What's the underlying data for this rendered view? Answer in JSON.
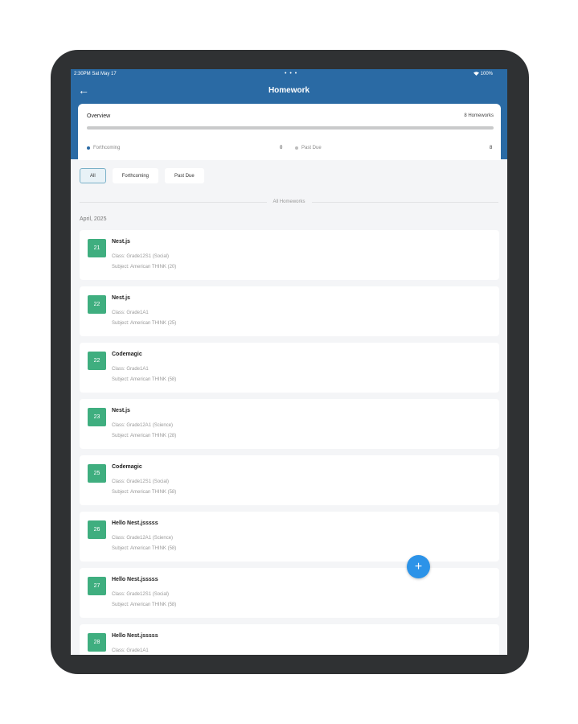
{
  "status_bar": {
    "time": "2:30PM  Sat May 17",
    "dots": "• • •",
    "battery": "100%"
  },
  "header": {
    "back_icon": "arrow-left-icon",
    "title": "Homework"
  },
  "overview": {
    "title": "Overview",
    "count": "8 Homeworks",
    "progress_fraction": 0,
    "legend": [
      {
        "label": "Forthcoming",
        "value": "0",
        "color": "#2a6aa4"
      },
      {
        "label": "Past Due",
        "value": "8",
        "color": "#bdbdbd"
      }
    ]
  },
  "filters": [
    {
      "label": "All",
      "active": true
    },
    {
      "label": "Forthcoming",
      "active": false
    },
    {
      "label": "Past Due",
      "active": false
    }
  ],
  "section_label": "All Homeworks",
  "month_label": "April, 2025",
  "homeworks": [
    {
      "day": "21",
      "title": "Nest.js",
      "class": "Class: Grade12S1 (Social)",
      "subject": "Subject: American THINK (20)"
    },
    {
      "day": "22",
      "title": "Nest.js",
      "class": "Class: Grade1A1",
      "subject": "Subject: American THINK (25)"
    },
    {
      "day": "22",
      "title": "Codemagic",
      "class": "Class: Grade1A1",
      "subject": "Subject: American THINK (58)"
    },
    {
      "day": "23",
      "title": "Nest.js",
      "class": "Class: Grade12A1 (Science)",
      "subject": "Subject: American THINK (28)"
    },
    {
      "day": "25",
      "title": "Codemagic",
      "class": "Class: Grade12S1 (Social)",
      "subject": "Subject: American THINK (58)"
    },
    {
      "day": "26",
      "title": "Hello Nest.jsssss",
      "class": "Class: Grade12A1 (Science)",
      "subject": "Subject: American THINK (58)"
    },
    {
      "day": "27",
      "title": "Hello Nest.jsssss",
      "class": "Class: Grade12S1 (Social)",
      "subject": "Subject: American THINK (58)"
    },
    {
      "day": "28",
      "title": "Hello Nest.jsssss",
      "class": "Class: Grade1A1",
      "subject": ""
    }
  ],
  "fab": {
    "icon": "plus-icon",
    "glyph": "+"
  },
  "colors": {
    "header": "#2a6aa4",
    "badge": "#3fae7f",
    "fab": "#2c93e8"
  }
}
